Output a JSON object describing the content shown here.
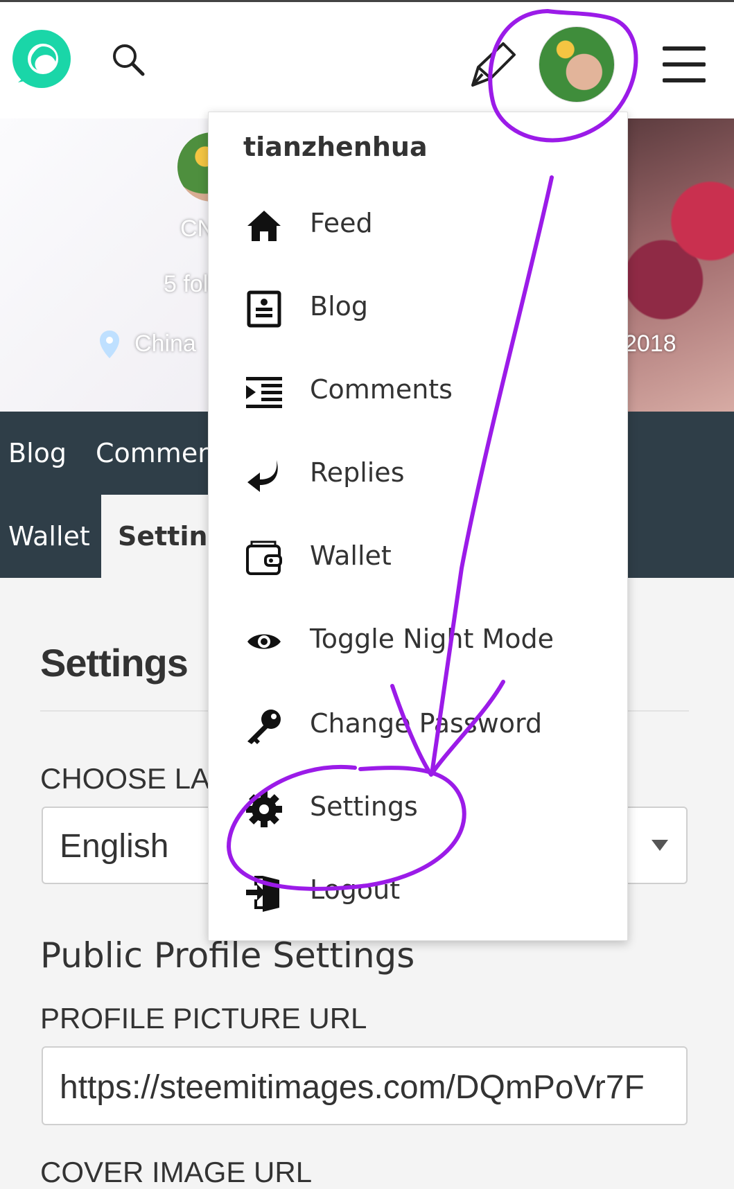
{
  "header": {
    "logo_icon": "steemit-logo-icon",
    "search_icon": "search-icon",
    "compose_icon": "pen-icon",
    "menu_icon": "hamburger-icon"
  },
  "profile": {
    "name_partial": "CN",
    "followers_partial": "5 fol",
    "location": "China",
    "joined_partial": "2018"
  },
  "tabs": {
    "row1": [
      "Blog",
      "Commen"
    ],
    "row2": [
      "Wallet",
      "Setting"
    ]
  },
  "settings": {
    "title": "Settings",
    "language_label": "CHOOSE LA",
    "language_value": "English",
    "public_profile_title": "Public Profile Settings",
    "profile_picture_label": "PROFILE PICTURE URL",
    "profile_picture_value": "https://steemitimages.com/DQmPoVr7F",
    "cover_image_label": "COVER IMAGE URL"
  },
  "dropdown": {
    "username": "tianzhenhua",
    "items": [
      {
        "label": "Feed",
        "icon": "home-icon"
      },
      {
        "label": "Blog",
        "icon": "blog-icon"
      },
      {
        "label": "Comments",
        "icon": "comments-icon"
      },
      {
        "label": "Replies",
        "icon": "reply-icon"
      },
      {
        "label": "Wallet",
        "icon": "wallet-icon"
      },
      {
        "label": "Toggle Night Mode",
        "icon": "eye-icon"
      },
      {
        "label": "Change Password",
        "icon": "key-icon"
      },
      {
        "label": "Settings",
        "icon": "gear-icon"
      },
      {
        "label": "Logout",
        "icon": "logout-icon"
      }
    ]
  },
  "colors": {
    "brand": "#1ad6a8",
    "tab_bar": "#2f3e48",
    "annotation": "#9b1be8"
  }
}
